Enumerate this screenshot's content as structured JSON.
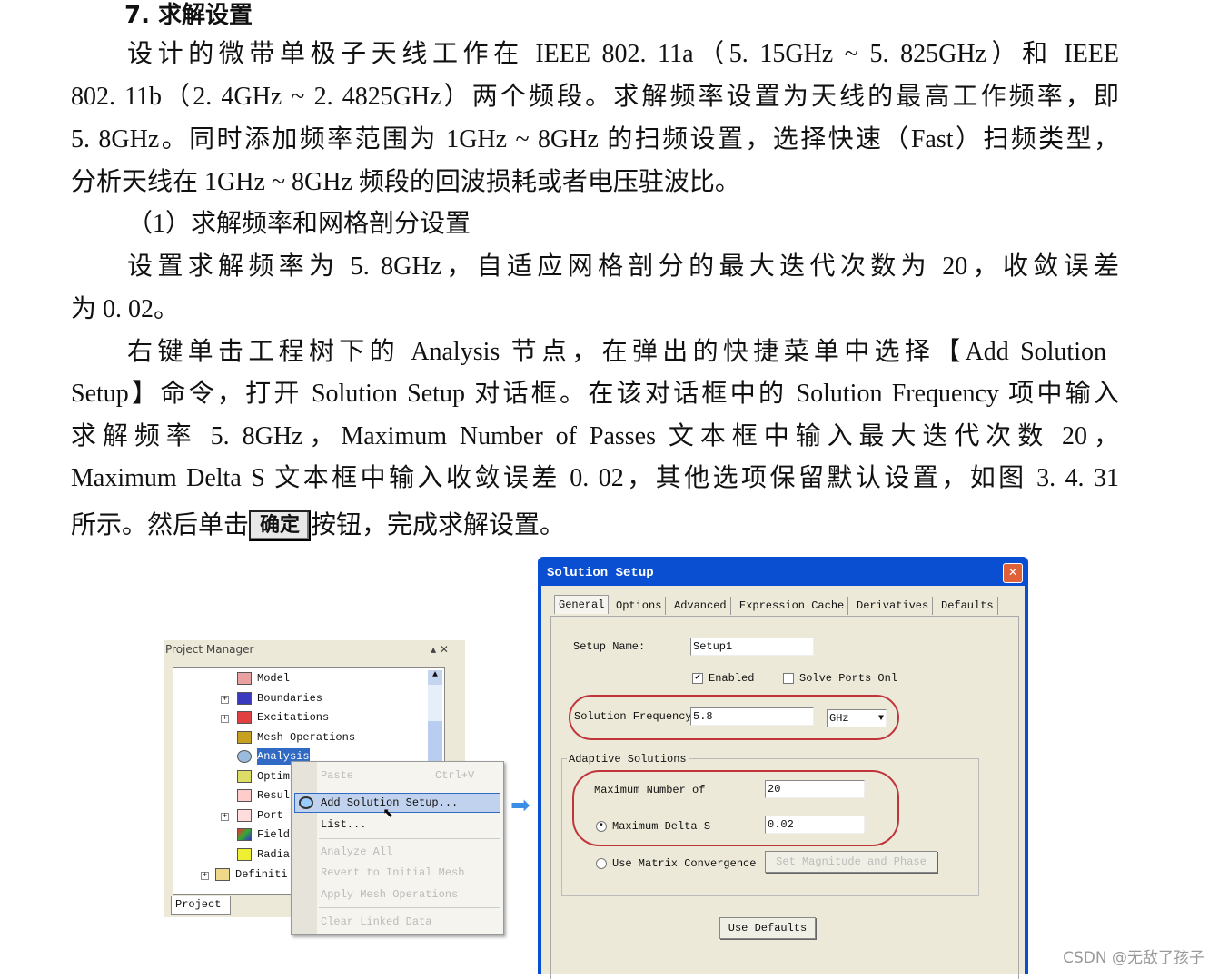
{
  "heading": "7. 求解设置",
  "paragraph_lines": [
    "设计的微带单极子天线工作在 IEEE 802. 11a（5. 15GHz ~ 5. 825GHz）和 IEEE",
    "802. 11b（2. 4GHz ~ 2. 4825GHz）两个频段。求解频率设置为天线的最高工作频率，即",
    "5. 8GHz。同时添加频率范围为 1GHz ~ 8GHz 的扫频设置，选择快速（Fast）扫频类型，",
    "分析天线在 1GHz ~ 8GHz 频段的回波损耗或者电压驻波比。",
    "（1）求解频率和网格剖分设置",
    "设置求解频率为 5. 8GHz，自适应网格剖分的最大迭代次数为 20，收敛误差",
    "为 0. 02。",
    "右键单击工程树下的 Analysis 节点，在弹出的快捷菜单中选择【Add Solution",
    "Setup】命令，打开 Solution Setup 对话框。在该对话框中的 Solution Frequency 项中输入",
    "求解频率 5. 8GHz，Maximum Number of Passes 文本框中输入最大迭代次数 20，",
    "Maximum Delta S 文本框中输入收敛误差 0. 02，其他选项保留默认设置，如图 3. 4. 31"
  ],
  "last_line": {
    "before": "所示。然后单击",
    "button": "确定",
    "after": "按钮，完成求解设置。"
  },
  "project_manager": {
    "title": "Project Manager",
    "tree": [
      "Model",
      "Boundaries",
      "Excitations",
      "Mesh Operations",
      "Analysis",
      "Optim",
      "Resul",
      "Port",
      "Field",
      "Radia",
      "Definiti"
    ],
    "tab": "Project"
  },
  "context_menu": {
    "items": [
      {
        "label": "Paste",
        "shortcut": "Ctrl+V",
        "enabled": false
      },
      {
        "label": "Add Solution Setup...",
        "enabled": true,
        "highlighted": true
      },
      {
        "label": "List...",
        "enabled": true
      },
      {
        "label": "Analyze All",
        "enabled": false
      },
      {
        "label": "Revert to Initial Mesh",
        "enabled": false
      },
      {
        "label": "Apply Mesh Operations",
        "enabled": false
      },
      {
        "label": "Clear Linked Data",
        "enabled": false
      }
    ]
  },
  "dialog": {
    "title": "Solution Setup",
    "tabs": [
      "General",
      "Options",
      "Advanced",
      "Expression Cache",
      "Derivatives",
      "Defaults"
    ],
    "setup_name_label": "Setup Name:",
    "setup_name": "Setup1",
    "enabled_label": "Enabled",
    "enabled": true,
    "solve_ports_label": "Solve Ports Onl",
    "solve_ports": false,
    "freq_label": "Solution Frequency",
    "freq": "5.8",
    "freq_unit": "GHz",
    "adaptive_label": "Adaptive Solutions",
    "max_passes_label": "Maximum Number of",
    "max_passes": "20",
    "max_delta_label": "Maximum Delta S",
    "max_delta": "0.02",
    "matrix_label": "Use Matrix Convergence",
    "set_mag_button": "Set Magnitude and Phase",
    "use_defaults_button": "Use Defaults"
  },
  "colors": {
    "highlight_ring": "#c0353a",
    "titlebar": "#0a4fd1",
    "selection": "#316ac5",
    "arrow": "#3a8ee6"
  },
  "watermark": "CSDN @无敌了孩子"
}
